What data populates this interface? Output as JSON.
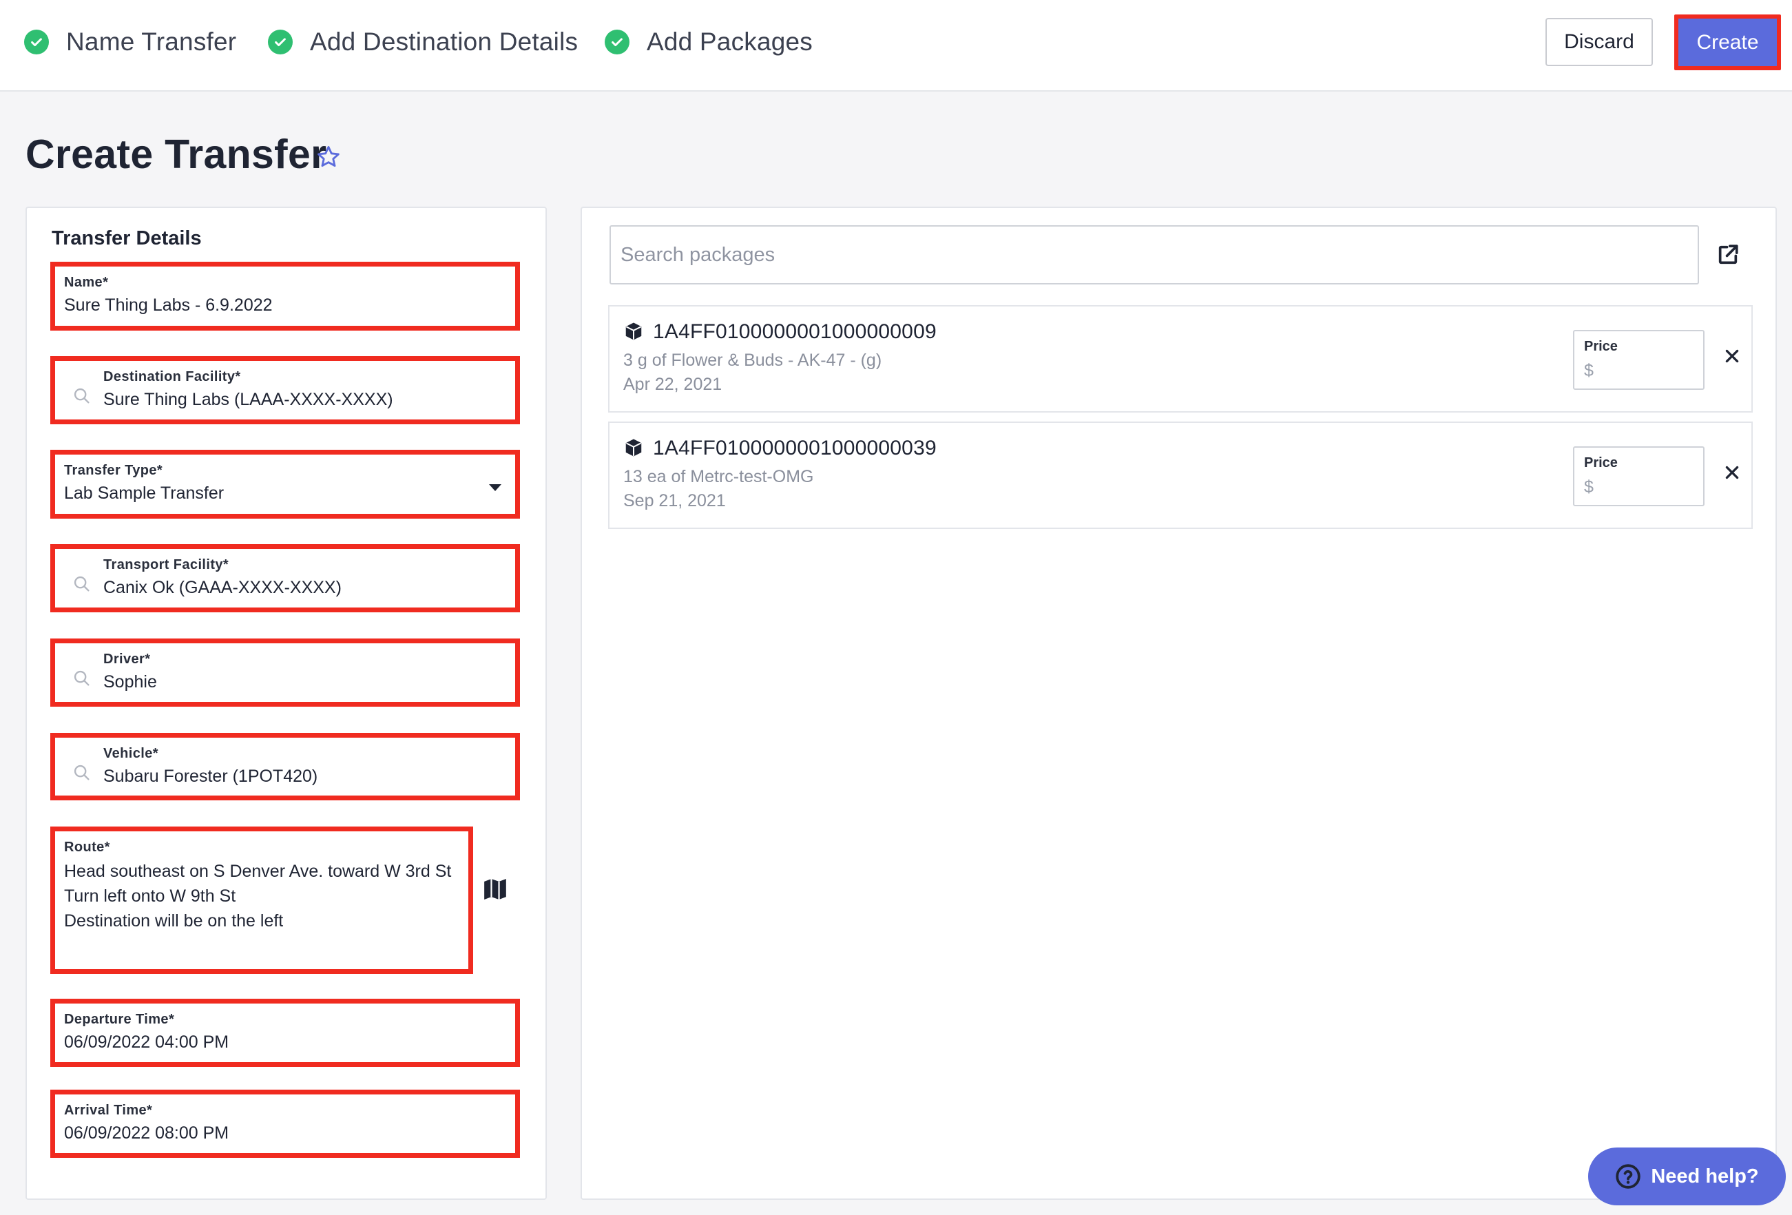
{
  "steps": [
    {
      "label": "Name Transfer"
    },
    {
      "label": "Add Destination Details"
    },
    {
      "label": "Add Packages"
    }
  ],
  "header": {
    "discard_label": "Discard",
    "create_label": "Create"
  },
  "page": {
    "title": "Create Transfer"
  },
  "transfer_details": {
    "title": "Transfer Details",
    "name": {
      "label": "Name*",
      "value": "Sure Thing Labs - 6.9.2022"
    },
    "destination_facility": {
      "label": "Destination Facility*",
      "value": "Sure Thing Labs (LAAA-XXXX-XXXX)"
    },
    "transfer_type": {
      "label": "Transfer Type*",
      "value": "Lab Sample Transfer"
    },
    "transport_facility": {
      "label": "Transport Facility*",
      "value": "Canix Ok (GAAA-XXXX-XXXX)"
    },
    "driver": {
      "label": "Driver*",
      "value": "Sophie"
    },
    "vehicle": {
      "label": "Vehicle*",
      "value": "Subaru Forester (1POT420)"
    },
    "route": {
      "label": "Route*",
      "lines": [
        "Head southeast on S Denver Ave. toward W 3rd St",
        "Turn left onto W 9th St",
        "Destination will be on the left"
      ]
    },
    "departure_time": {
      "label": "Departure Time*",
      "value": "06/09/2022 04:00 PM"
    },
    "arrival_time": {
      "label": "Arrival Time*",
      "value": "06/09/2022 08:00 PM"
    }
  },
  "packages": {
    "search_placeholder": "Search packages",
    "items": [
      {
        "tag": "1A4FF0100000001000000009",
        "description": "3 g of Flower & Buds - AK-47 - (g)",
        "date": "Apr 22, 2021",
        "price_label": "Price",
        "price_symbol": "$"
      },
      {
        "tag": "1A4FF0100000001000000039",
        "description": "13 ea of Metrc-test-OMG",
        "date": "Sep 21, 2021",
        "price_label": "Price",
        "price_symbol": "$"
      }
    ]
  },
  "help": {
    "label": "Need help?"
  },
  "colors": {
    "accent": "#5b6bdc",
    "success": "#2fbf71",
    "highlight": "#f02b20"
  }
}
